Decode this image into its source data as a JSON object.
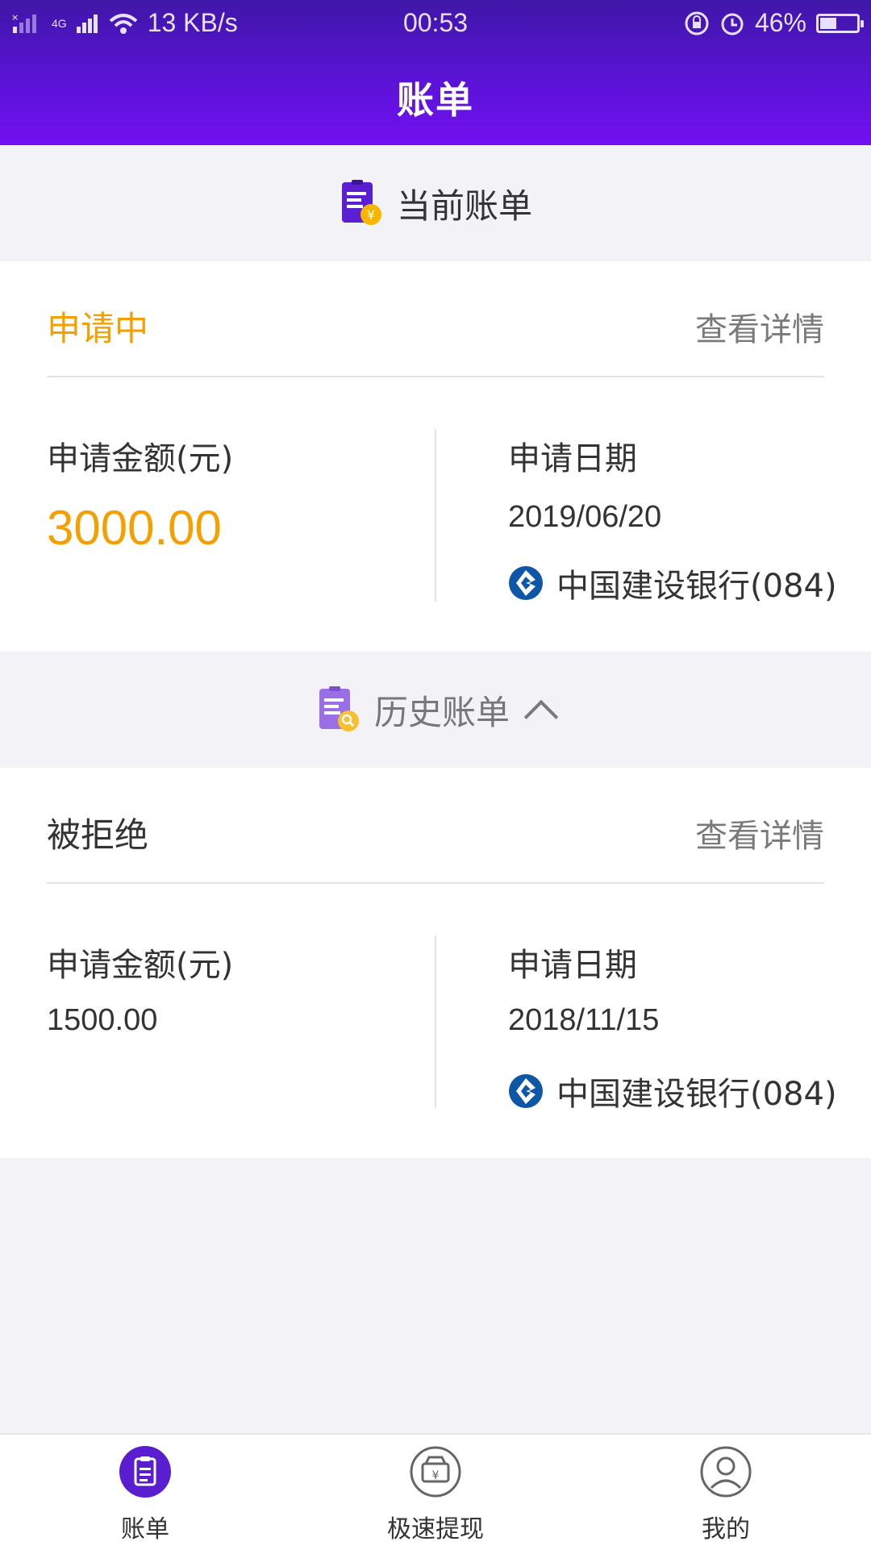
{
  "status_bar": {
    "network_speed": "13 KB/s",
    "time": "00:53",
    "battery": "46%",
    "battery_level": 0.46,
    "signal_label": "4G"
  },
  "header": {
    "title": "账单"
  },
  "current_section": {
    "title": "当前账单",
    "icon": "bill-yuan-icon"
  },
  "current_bill": {
    "status": "申请中",
    "details_link": "查看详情",
    "amount_label": "申请金额(元)",
    "amount": "3000.00",
    "date_label": "申请日期",
    "date": "2019/06/20",
    "bank": "中国建设银行(084)"
  },
  "history_section": {
    "title": "历史账单",
    "icon": "bill-search-icon",
    "toggle_icon": "chevron-up-icon"
  },
  "history_bills": [
    {
      "status": "被拒绝",
      "details_link": "查看详情",
      "amount_label": "申请金额(元)",
      "amount": "1500.00",
      "date_label": "申请日期",
      "date": "2018/11/15",
      "bank": "中国建设银行(084)"
    }
  ],
  "tabbar": {
    "items": [
      {
        "label": "账单",
        "icon": "bill-icon",
        "active": true
      },
      {
        "label": "极速提现",
        "icon": "cash-withdraw-icon",
        "active": false
      },
      {
        "label": "我的",
        "icon": "profile-icon",
        "active": false
      }
    ]
  },
  "colors": {
    "header_top": "#3f17a8",
    "header_bottom": "#7310f0",
    "accent_orange": "#f5a000",
    "active_tab": "#5a1ed0"
  }
}
